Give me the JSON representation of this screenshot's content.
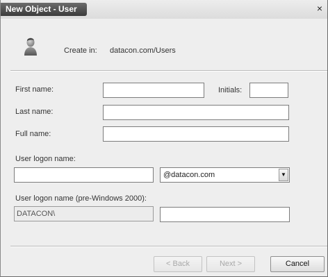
{
  "window": {
    "title": "New Object - User",
    "close_label": "×"
  },
  "header": {
    "create_in_label": "Create in:",
    "create_in_value": "datacon.com/Users"
  },
  "form": {
    "first_name_label": "First name:",
    "first_name_value": "",
    "initials_label": "Initials:",
    "initials_value": "",
    "last_name_label": "Last name:",
    "last_name_value": "",
    "full_name_label": "Full name:",
    "full_name_value": "",
    "logon_name_label": "User logon name:",
    "logon_name_value": "",
    "domain_selected": "@datacon.com",
    "pre2000_label": "User logon name (pre-Windows 2000):",
    "pre2000_domain": "DATACON\\",
    "pre2000_value": ""
  },
  "buttons": {
    "back": "< Back",
    "next": "Next >",
    "cancel": "Cancel"
  },
  "icons": {
    "user": "user-icon",
    "close": "close-icon",
    "dropdown": "chevron-down-icon"
  }
}
